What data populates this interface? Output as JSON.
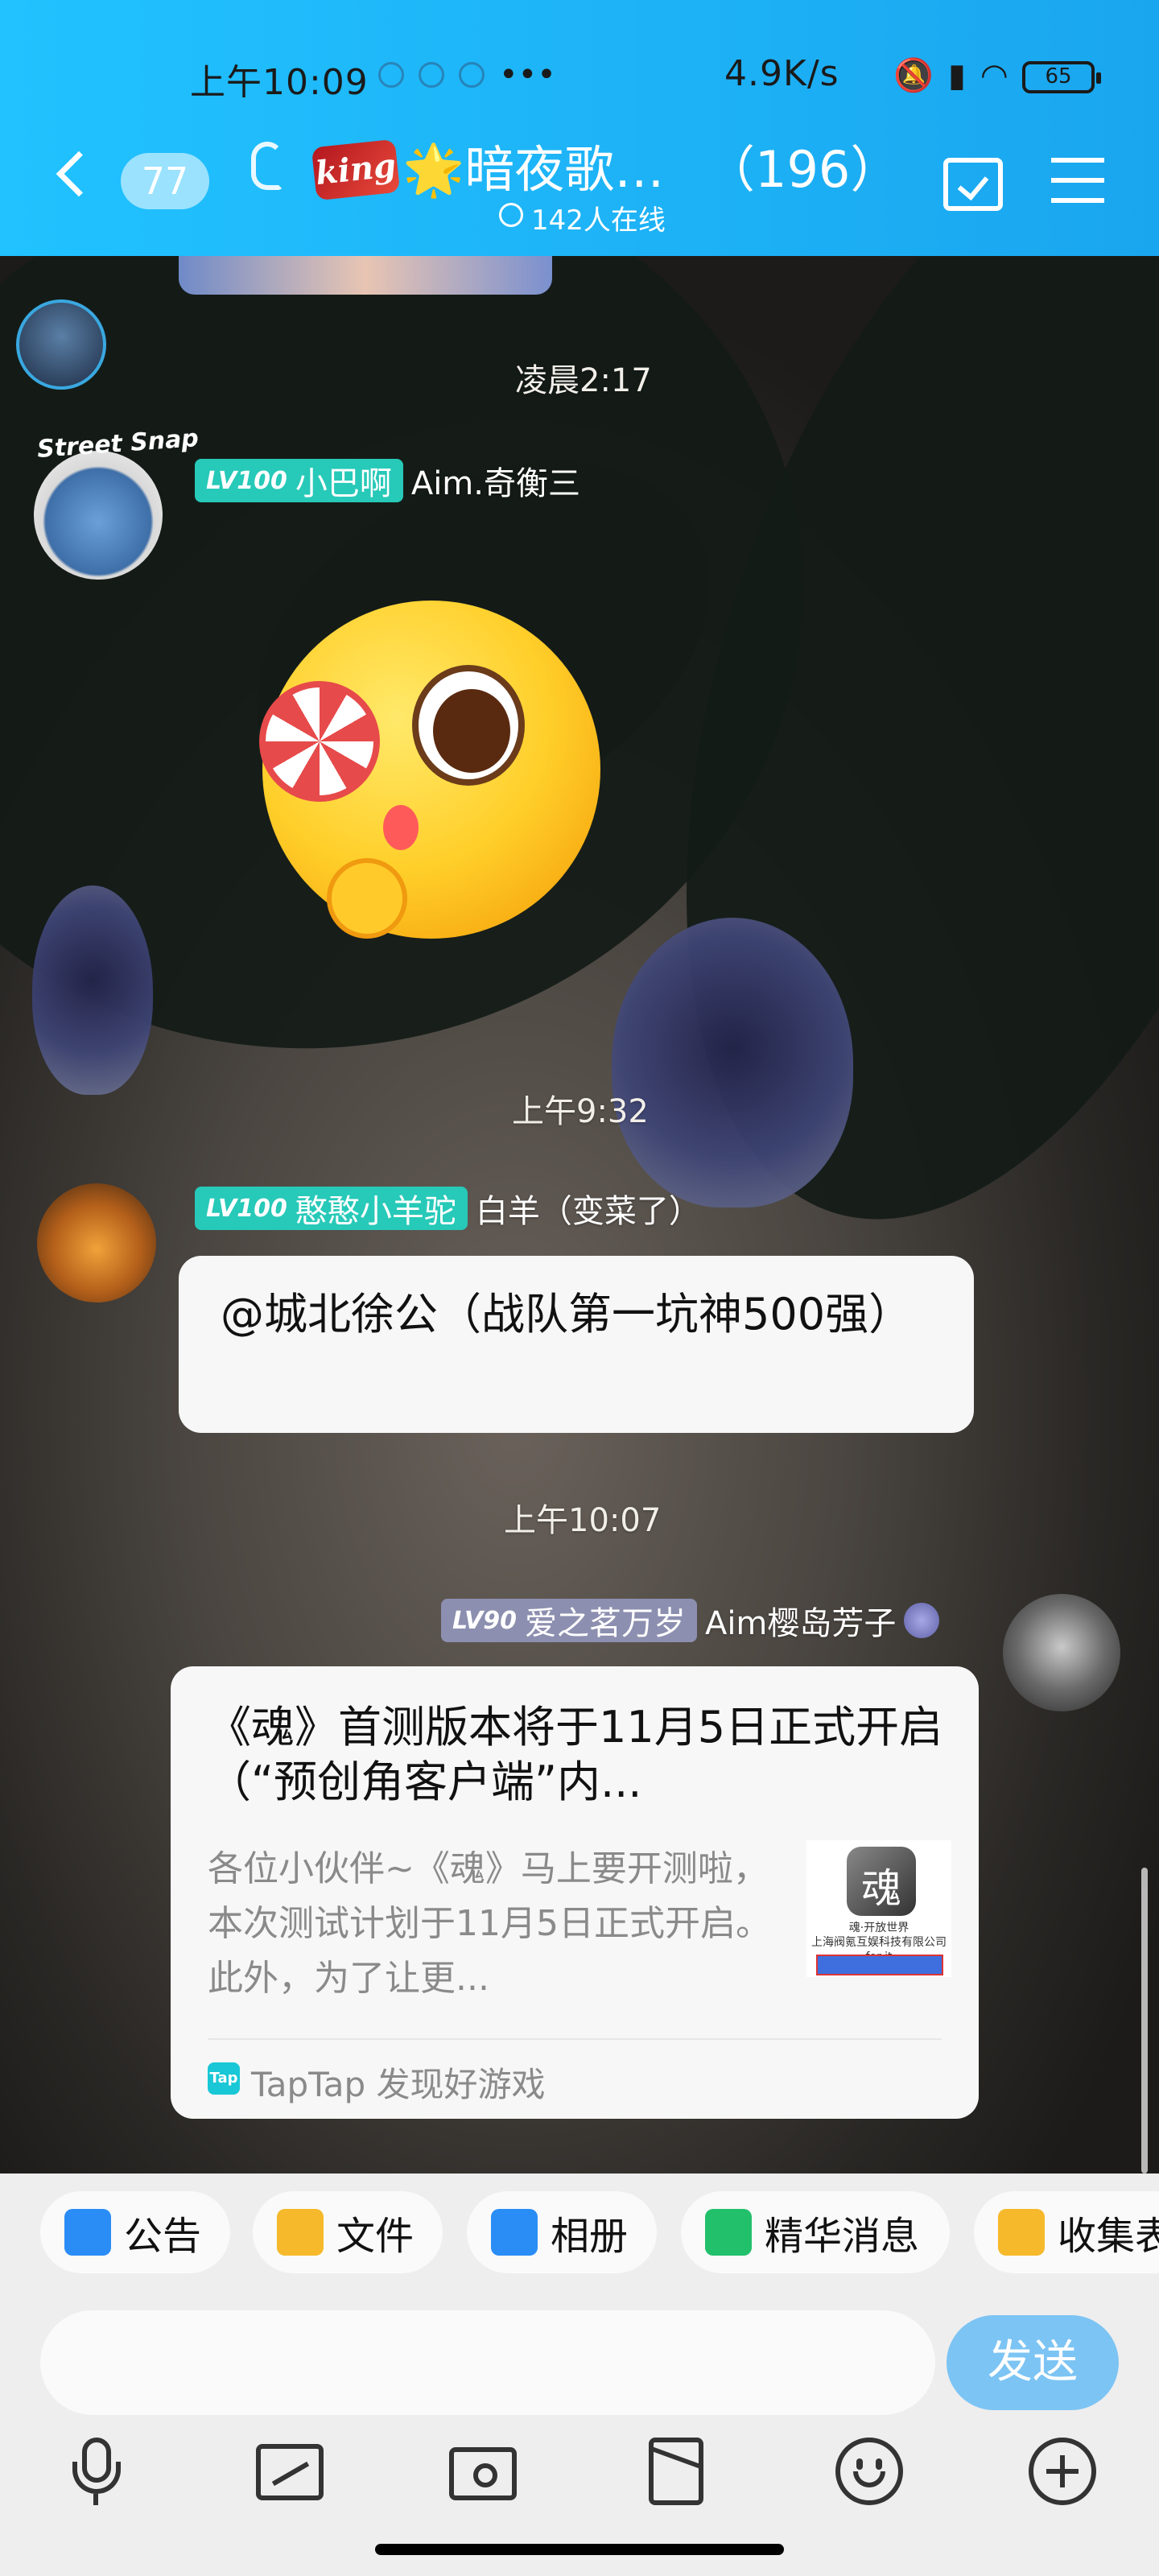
{
  "status_bar": {
    "time": "上午10:09",
    "network_speed": "4.9K/s",
    "battery": "65"
  },
  "header": {
    "back_badge": "77",
    "king_tag": "king",
    "group_title": "🌟暗夜歌…",
    "member_count": "（196）",
    "online": "142人在线"
  },
  "chat": {
    "timestamps": [
      "凌晨2:17",
      "上午9:32",
      "上午10:07"
    ],
    "messages": [
      {
        "level": "LV100",
        "title": "小巴啊",
        "nickname": "Aim.奇衡三",
        "level_color": "#27c9b8",
        "sticker": "lollipop-emoji-sticker"
      },
      {
        "level": "LV100",
        "title": "憨憨小羊驼",
        "nickname": "白羊（变菜了）",
        "level_color": "#27c9b8",
        "text": "@城北徐公（战队第一坑神500强）"
      },
      {
        "level": "LV90",
        "title": "爱之茗万岁",
        "nickname": "Aim樱岛芳子",
        "level_color": "#8d8fb0"
      }
    ],
    "share_card": {
      "title": "《魂》首测版本将于11月5日正式开启（“预创角客户端”内...",
      "description": "各位小伙伴~《魂》马上要开测啦，本次测试计划于11月5日正式开启。此外，为了让更...",
      "thumb_caption": "魂·开放世界\n上海阀氪互娱科技有限公司 for it",
      "source_logo": "Tap",
      "source": "TapTap 发现好游戏"
    }
  },
  "quick_tools": [
    {
      "label": "公告",
      "icon": "announcement-icon",
      "color": "#2a8df5"
    },
    {
      "label": "文件",
      "icon": "folder-icon",
      "color": "#f5b92b"
    },
    {
      "label": "相册",
      "icon": "album-icon",
      "color": "#2a8df5"
    },
    {
      "label": "精华消息",
      "icon": "highlight-message-icon",
      "color": "#22c06b"
    },
    {
      "label": "收集表",
      "icon": "form-icon",
      "color": "#f5b92b"
    }
  ],
  "input": {
    "placeholder": "",
    "send_label": "发送"
  },
  "toolbar_icons": [
    "microphone-icon",
    "image-icon",
    "camera-icon",
    "red-packet-icon",
    "emoji-icon",
    "plus-icon"
  ]
}
